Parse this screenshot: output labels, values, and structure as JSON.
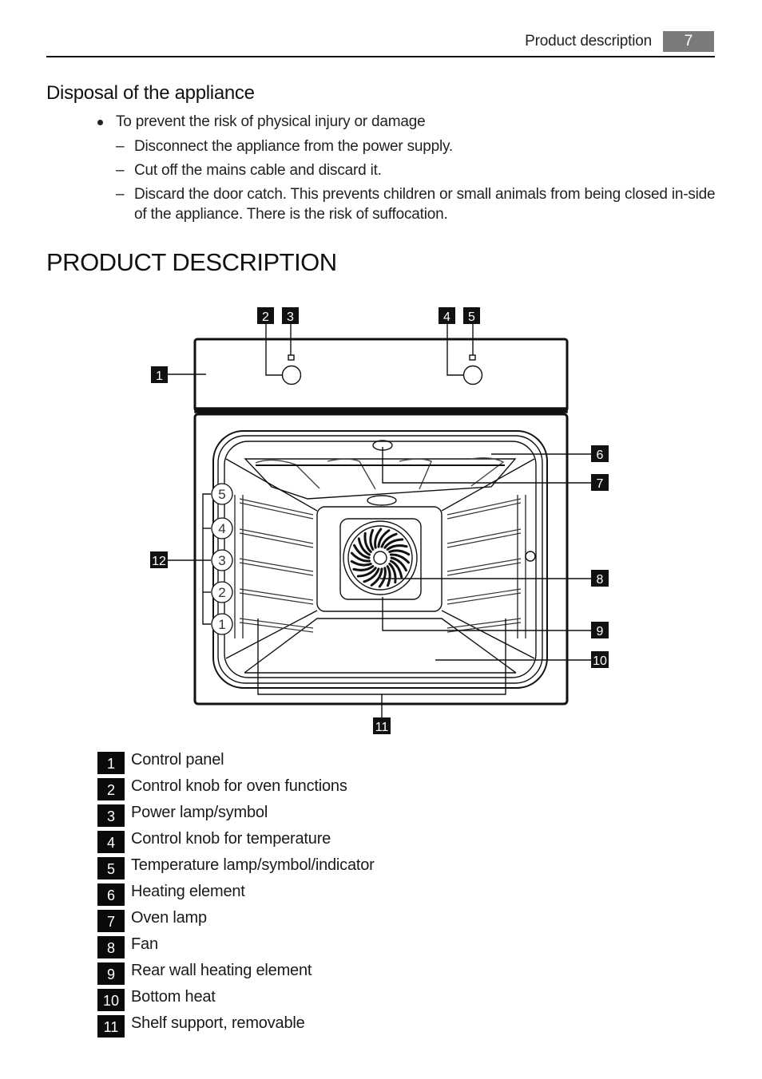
{
  "header": {
    "running_title": "Product description",
    "page_number": "7"
  },
  "disposal": {
    "heading": "Disposal of the appliance",
    "bullet": "To prevent the risk of physical injury or damage",
    "dash_symbol": "–",
    "steps": [
      "Disconnect the appliance from the power supply.",
      "Cut off the mains cable and discard it.",
      "Discard the door catch. This prevents children or small animals from being closed in-side of the appliance. There is the risk of suffocation."
    ]
  },
  "chapter": {
    "title": "PRODUCT DESCRIPTION"
  },
  "diagram": {
    "callouts": [
      "1",
      "2",
      "3",
      "4",
      "5",
      "6",
      "7",
      "8",
      "9",
      "10",
      "11",
      "12"
    ],
    "shelf_levels": [
      "5",
      "4",
      "3",
      "2",
      "1"
    ]
  },
  "legend": [
    {
      "num": "1",
      "label": "Control panel"
    },
    {
      "num": "2",
      "label": "Control knob for oven functions"
    },
    {
      "num": "3",
      "label": "Power lamp/symbol"
    },
    {
      "num": "4",
      "label": "Control knob for temperature"
    },
    {
      "num": "5",
      "label": "Temperature lamp/symbol/indicator"
    },
    {
      "num": "6",
      "label": "Heating element"
    },
    {
      "num": "7",
      "label": "Oven lamp"
    },
    {
      "num": "8",
      "label": "Fan"
    },
    {
      "num": "9",
      "label": "Rear wall heating element"
    },
    {
      "num": "10",
      "label": "Bottom heat"
    },
    {
      "num": "11",
      "label": "Shelf support, removable"
    }
  ]
}
